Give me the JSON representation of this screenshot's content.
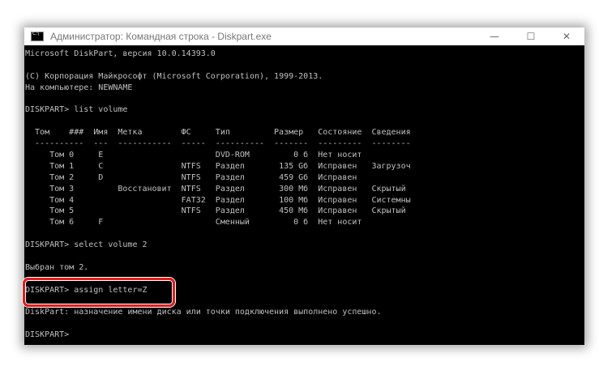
{
  "window": {
    "title": "Администратор: Командная строка - Diskpart.exe",
    "controls": {
      "minimize": "—",
      "maximize": "☐",
      "close": "✕"
    }
  },
  "console": {
    "intro": [
      "Microsoft DiskPart, версия 10.0.14393.0",
      "",
      "(C) Корпорация Майкрософт (Microsoft Corporation), 1999-2013.",
      "На компьютере: NEWNAME",
      "",
      "DISKPART> list volume",
      ""
    ],
    "table": {
      "headers": [
        "Том",
        "###",
        "Имя",
        "Метка",
        "ФС",
        "Тип",
        "Размер",
        "Состояние",
        "Сведения"
      ],
      "separator": "  ----------  ---  -----------  -----  ----------  -------  ---------  --------",
      "rows": [
        [
          "Том 0",
          "E",
          "",
          "",
          "DVD-ROM",
          "0 б",
          "Нет носит",
          ""
        ],
        [
          "Том 1",
          "C",
          "",
          "NTFS",
          "Раздел",
          "135 Gб",
          "Исправен",
          "Загрузоч"
        ],
        [
          "Том 2",
          "D",
          "",
          "NTFS",
          "Раздел",
          "459 Gб",
          "Исправен",
          ""
        ],
        [
          "Том 3",
          "",
          "Восстановит",
          "NTFS",
          "Раздел",
          "300 Мб",
          "Исправен",
          "Скрытый"
        ],
        [
          "Том 4",
          "",
          "",
          "FAT32",
          "Раздел",
          "100 Мб",
          "Исправен",
          "Системны"
        ],
        [
          "Том 5",
          "",
          "",
          "NTFS",
          "Раздел",
          "450 Мб",
          "Исправен",
          "Скрытый"
        ],
        [
          "Том 6",
          "F",
          "",
          "",
          "Сменный",
          "0 б",
          "Нет носит",
          ""
        ]
      ]
    },
    "outro": [
      "",
      "DISKPART> select volume 2",
      "",
      "Выбран том 2.",
      "",
      "DISKPART> assign letter=Z",
      "",
      "DiskPart: назначение имени диска или точки подключения выполнено успешно.",
      "",
      "DISKPART> "
    ]
  },
  "colors": {
    "console_bg": "#000000",
    "console_text": "#c0c0c0",
    "highlight": "#e31b1b"
  }
}
